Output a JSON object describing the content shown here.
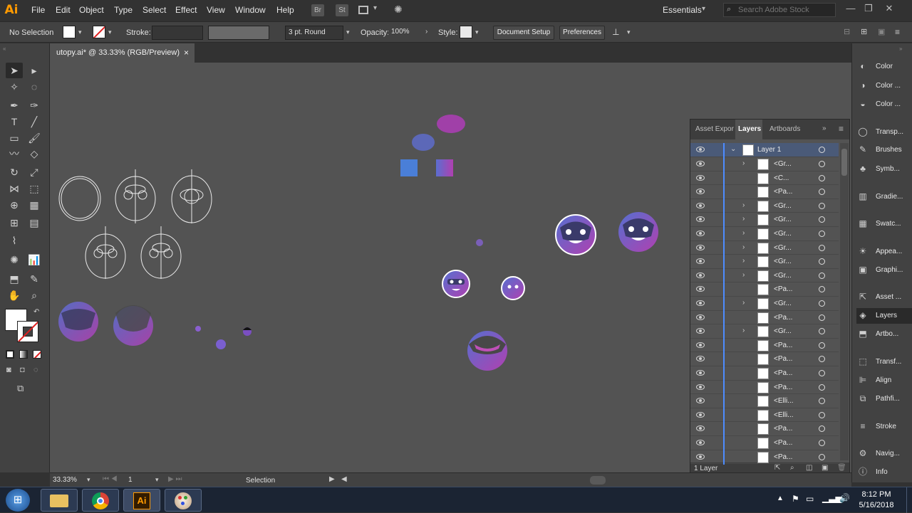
{
  "app": {
    "logo": "Ai"
  },
  "menu": [
    "File",
    "Edit",
    "Object",
    "Type",
    "Select",
    "Effect",
    "View",
    "Window",
    "Help"
  ],
  "app_buttons": [
    "Br",
    "St"
  ],
  "workspace": "Essentials",
  "search": {
    "placeholder": "Search Adobe Stock"
  },
  "control_bar": {
    "selection": "No Selection",
    "stroke_label": "Stroke:",
    "brush": "3 pt. Round",
    "opacity_label": "Opacity:",
    "opacity_value": "100%",
    "style_label": "Style:",
    "document_setup": "Document Setup",
    "preferences": "Preferences"
  },
  "document": {
    "tab_title": "utopy.ai* @ 33.33% (RGB/Preview)",
    "close": "×"
  },
  "layers_panel": {
    "tabs": [
      "Asset Expor",
      "Layers",
      "Artboards"
    ],
    "layer_name": "Layer 1",
    "rows": [
      {
        "name": "<Gr...",
        "arrow": true
      },
      {
        "name": "<C...",
        "arrow": false
      },
      {
        "name": "<Pa...",
        "arrow": false
      },
      {
        "name": "<Gr...",
        "arrow": true
      },
      {
        "name": "<Gr...",
        "arrow": true
      },
      {
        "name": "<Gr...",
        "arrow": true
      },
      {
        "name": "<Gr...",
        "arrow": true
      },
      {
        "name": "<Gr...",
        "arrow": true
      },
      {
        "name": "<Gr...",
        "arrow": true
      },
      {
        "name": "<Pa...",
        "arrow": false
      },
      {
        "name": "<Gr...",
        "arrow": true
      },
      {
        "name": "<Pa...",
        "arrow": false
      },
      {
        "name": "<Gr...",
        "arrow": true
      },
      {
        "name": "<Pa...",
        "arrow": false
      },
      {
        "name": "<Pa...",
        "arrow": false
      },
      {
        "name": "<Pa...",
        "arrow": false
      },
      {
        "name": "<Pa...",
        "arrow": false
      },
      {
        "name": "<Elli...",
        "arrow": false
      },
      {
        "name": "<Elli...",
        "arrow": false
      },
      {
        "name": "<Pa...",
        "arrow": false
      },
      {
        "name": "<Pa...",
        "arrow": false
      },
      {
        "name": "<Pa...",
        "arrow": false
      }
    ],
    "footer": "1 Layer"
  },
  "right_panel": [
    {
      "label": "Color",
      "icon": "color-icon"
    },
    {
      "label": "Color ...",
      "icon": "color-guide-icon"
    },
    {
      "label": "Color ...",
      "icon": "color-themes-icon"
    },
    {
      "label": "Transp...",
      "icon": "transparency-icon"
    },
    {
      "label": "Brushes",
      "icon": "brushes-icon"
    },
    {
      "label": "Symb...",
      "icon": "symbols-icon"
    },
    {
      "label": "Gradie...",
      "icon": "gradient-icon"
    },
    {
      "label": "Swatc...",
      "icon": "swatches-icon"
    },
    {
      "label": "Appea...",
      "icon": "appearance-icon"
    },
    {
      "label": "Graphi...",
      "icon": "graphic-styles-icon"
    },
    {
      "label": "Asset ...",
      "icon": "asset-export-icon"
    },
    {
      "label": "Layers",
      "icon": "layers-icon"
    },
    {
      "label": "Artbo...",
      "icon": "artboards-icon"
    },
    {
      "label": "Transf...",
      "icon": "transform-icon"
    },
    {
      "label": "Align",
      "icon": "align-icon"
    },
    {
      "label": "Pathfi...",
      "icon": "pathfinder-icon"
    },
    {
      "label": "Stroke",
      "icon": "stroke-icon"
    },
    {
      "label": "Navig...",
      "icon": "navigator-icon"
    },
    {
      "label": "Info",
      "icon": "info-icon"
    }
  ],
  "status": {
    "zoom": "33.33%",
    "artboard": "1",
    "tool": "Selection"
  },
  "taskbar": {
    "time": "8:12 PM",
    "date": "5/16/2018"
  },
  "colors": {
    "accent": "#4d8cff",
    "ai_orange": "#ff9a00",
    "purple": "#8a4fc4",
    "magenta": "#b040b0"
  }
}
